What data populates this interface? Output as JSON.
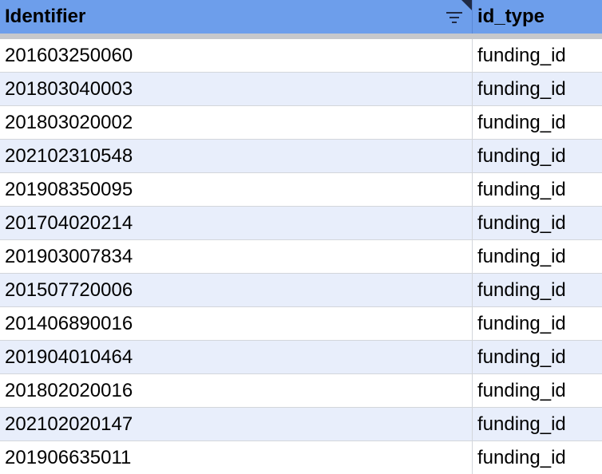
{
  "header": {
    "identifier_label": "Identifier",
    "id_type_label": "id_type",
    "filter_icon": "filter-icon",
    "header_color": "#6d9eeb",
    "band_color": "#e8eefb"
  },
  "rows": [
    {
      "identifier": "201603250060",
      "id_type": "funding_id"
    },
    {
      "identifier": "201803040003",
      "id_type": "funding_id"
    },
    {
      "identifier": "201803020002",
      "id_type": "funding_id"
    },
    {
      "identifier": "202102310548",
      "id_type": "funding_id"
    },
    {
      "identifier": "201908350095",
      "id_type": "funding_id"
    },
    {
      "identifier": "201704020214",
      "id_type": "funding_id"
    },
    {
      "identifier": "201903007834",
      "id_type": "funding_id"
    },
    {
      "identifier": "201507720006",
      "id_type": "funding_id"
    },
    {
      "identifier": "201406890016",
      "id_type": "funding_id"
    },
    {
      "identifier": "201904010464",
      "id_type": "funding_id"
    },
    {
      "identifier": "201802020016",
      "id_type": "funding_id"
    },
    {
      "identifier": "202102020147",
      "id_type": "funding_id"
    },
    {
      "identifier": "201906635011",
      "id_type": "funding_id"
    }
  ]
}
